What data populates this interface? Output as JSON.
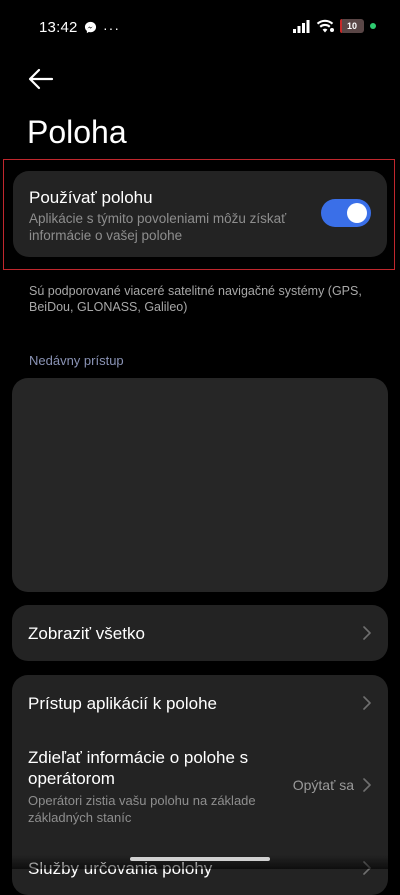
{
  "status_bar": {
    "time": "13:42",
    "battery_level": "10",
    "battery_fraction": 0.1,
    "more_glyph": "···",
    "icons": [
      "messenger-icon",
      "more-dots-icon",
      "signal-icon",
      "wifi-icon",
      "battery-icon",
      "charging-dot-icon"
    ]
  },
  "header": {
    "back_icon": "arrow-left-icon",
    "title": "Poloha"
  },
  "location_card": {
    "title": "Používať polohu",
    "description": "Aplikácie s týmito povoleniami môžu získať informácie o vašej polohe",
    "toggle_on": true
  },
  "gnss_note": "Sú podporované viaceré satelitné navigačné systémy (GPS, BeiDou, GLONASS, Galileo)",
  "recent_access": {
    "header": "Nedávny prístup"
  },
  "show_all": {
    "label": "Zobraziť všetko"
  },
  "app_settings": {
    "items": [
      {
        "label": "Prístup aplikácií k polohe"
      },
      {
        "label": "Zdieľať informácie o polohe s operátorom",
        "sub": "Operátori zistia vašu polohu na základe základných staníc",
        "value": "Opýtať sa"
      },
      {
        "label": "Služby určovania polohy"
      }
    ]
  },
  "colors": {
    "background": "#000000",
    "card": "#232323",
    "accent_toggle": "#3a6fe8",
    "section_header": "#8a93b5",
    "highlight_frame": "#c0272d"
  }
}
